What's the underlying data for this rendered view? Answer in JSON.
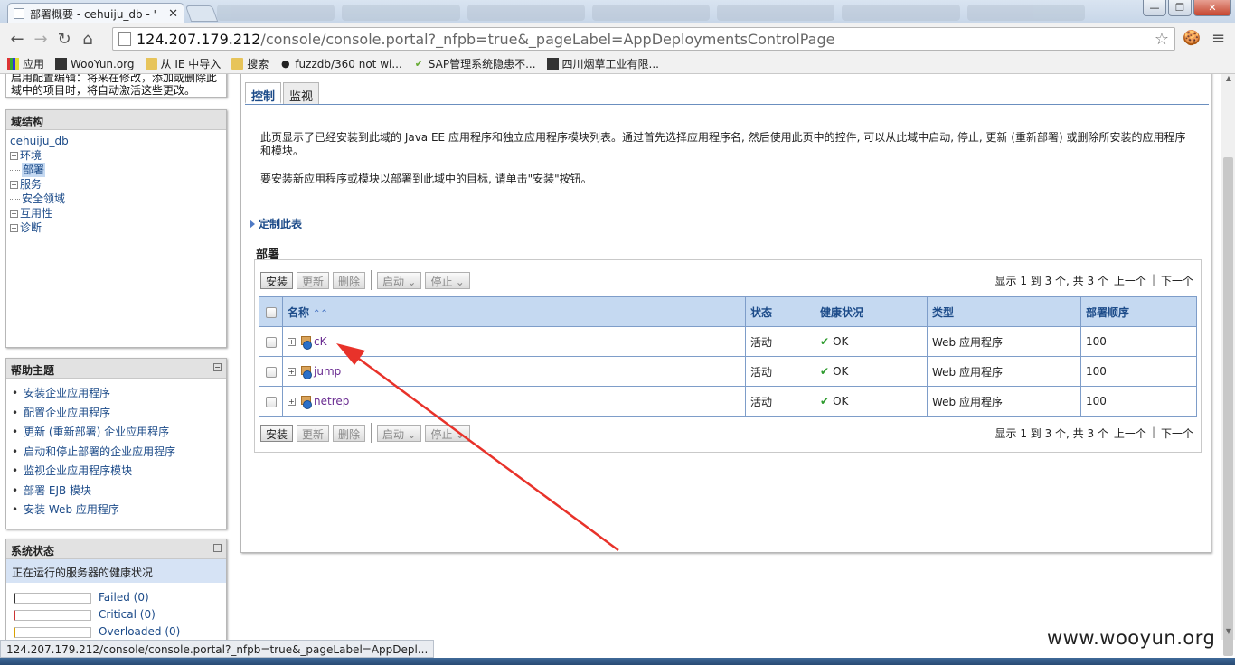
{
  "browser": {
    "tab_title": "部署概要 - cehuiju_db - '",
    "tab_close": "✕",
    "url_host": "124.207.179.212",
    "url_path": "/console/console.portal?_nfpb=true&_pageLabel=AppDeploymentsControlPage",
    "window_buttons": {
      "minimize": "—",
      "maximize": "❐",
      "close": "✕"
    },
    "icons": {
      "back": "back-arrow-icon",
      "forward": "forward-arrow-icon",
      "reload": "reload-icon",
      "home": "home-icon",
      "star": "star-icon",
      "menu": "menu-icon"
    },
    "bookmarks": [
      {
        "label": "应用",
        "icon": "apps"
      },
      {
        "label": "WooYun.org",
        "icon": "dark"
      },
      {
        "label": "从 IE 中导入",
        "icon": "folder"
      },
      {
        "label": "搜索",
        "icon": "folder"
      },
      {
        "label": "fuzzdb/360 not wi...",
        "icon": "github"
      },
      {
        "label": "SAP管理系统隐患不...",
        "icon": "sap"
      },
      {
        "label": "四川烟草工业有限...",
        "icon": "dark"
      }
    ],
    "status_url": "124.207.179.212/console/console.portal?_nfpb=true&_pageLabel=AppDepl..."
  },
  "left": {
    "change_center_text": "启用配置编辑：将来在修改，添加或删除此域中的项目时，将自动激活这些更改。",
    "domain_structure": {
      "title": "域结构",
      "root": "cehuiju_db",
      "items": [
        {
          "label": "环境",
          "expandable": true
        },
        {
          "label": "部署",
          "expandable": false,
          "selected": true
        },
        {
          "label": "服务",
          "expandable": true
        },
        {
          "label": "安全领域",
          "expandable": false
        },
        {
          "label": "互用性",
          "expandable": true
        },
        {
          "label": "诊断",
          "expandable": true
        }
      ]
    },
    "help": {
      "title": "帮助主题",
      "items": [
        "安装企业应用程序",
        "配置企业应用程序",
        "更新 (重新部署) 企业应用程序",
        "启动和停止部署的企业应用程序",
        "监视企业应用程序模块",
        "部署 EJB 模块",
        "安装 Web 应用程序"
      ]
    },
    "system_status": {
      "title": "系统状态",
      "subtitle": "正在运行的服务器的健康状况",
      "rows": [
        "Failed (0)",
        "Critical (0)",
        "Overloaded (0)"
      ]
    }
  },
  "main": {
    "tabs": [
      "控制",
      "监视"
    ],
    "description1": "此页显示了已经安装到此域的 Java EE 应用程序和独立应用程序模块列表。通过首先选择应用程序名, 然后使用此页中的控件, 可以从此域中启动, 停止, 更新 (重新部署) 或删除所安装的应用程序和模块。",
    "description2": "要安装新应用程序或模块以部署到此域中的目标, 请单击\"安装\"按钮。",
    "customize": "定制此表",
    "section_title": "部署",
    "buttons": {
      "install": "安装",
      "update": "更新",
      "delete": "删除",
      "start": "启动",
      "stop": "停止"
    },
    "pager": {
      "summary": "显示 1 到 3 个, 共 3 个",
      "prev": "上一个",
      "next": "下一个"
    },
    "table": {
      "headers": [
        "名称",
        "状态",
        "健康状况",
        "类型",
        "部署顺序"
      ],
      "rows": [
        {
          "name": "cK",
          "state": "活动",
          "health": "OK",
          "type": "Web 应用程序",
          "order": "100"
        },
        {
          "name": "jump",
          "state": "活动",
          "health": "OK",
          "type": "Web 应用程序",
          "order": "100"
        },
        {
          "name": "netrep",
          "state": "活动",
          "health": "OK",
          "type": "Web 应用程序",
          "order": "100"
        }
      ]
    }
  },
  "watermark": "www.wooyun.org",
  "colors": {
    "accent": "#1c4b89",
    "header_bg": "#c5d9f1",
    "arrow": "#e8322a",
    "ok": "#2e9b2e"
  }
}
